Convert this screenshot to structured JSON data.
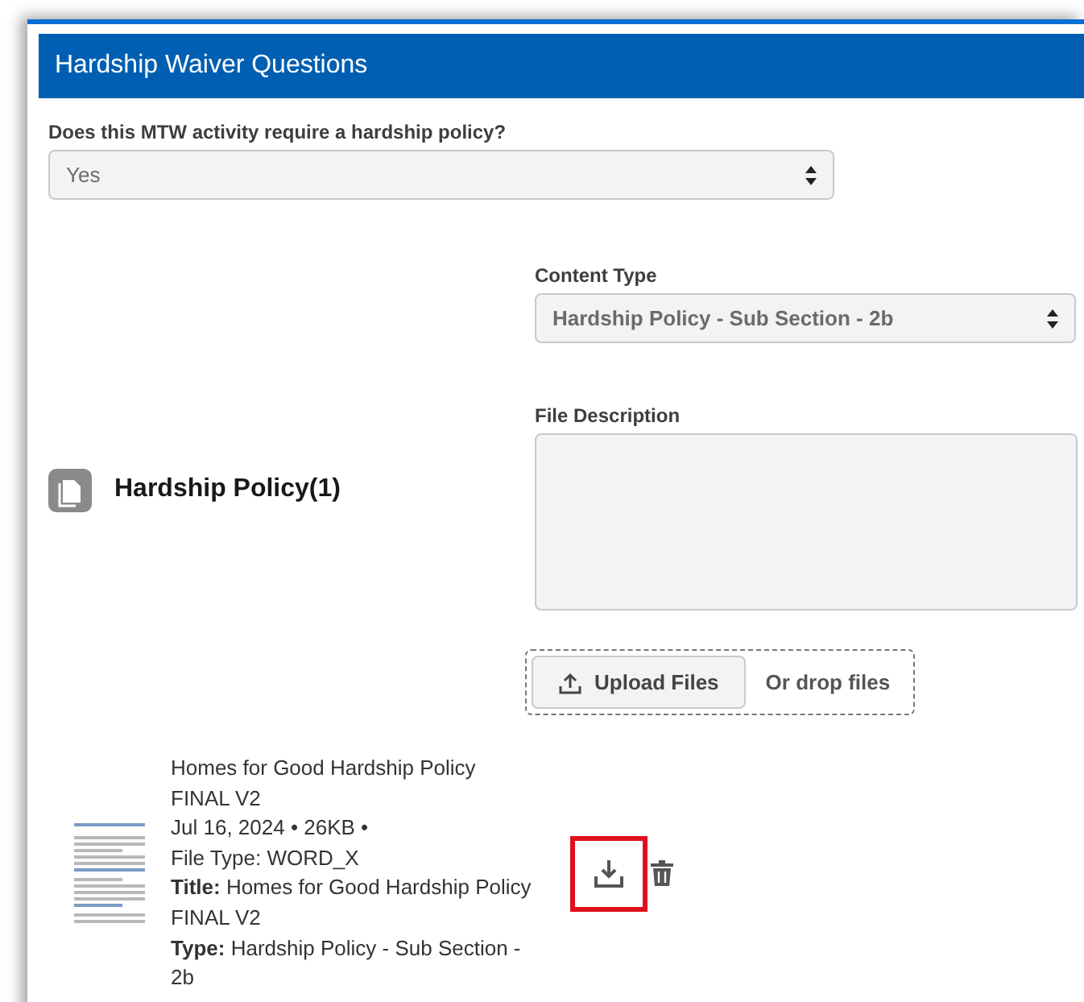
{
  "header": {
    "title": "Hardship Waiver Questions"
  },
  "question": {
    "label": "Does this MTW activity require a hardship policy?",
    "value": "Yes"
  },
  "section": {
    "title": "Hardship Policy(1)"
  },
  "content_type": {
    "label": "Content Type",
    "value": "Hardship Policy - Sub Section - 2b"
  },
  "file_description": {
    "label": "File Description"
  },
  "upload": {
    "button": "Upload Files",
    "drop_text": "Or drop files"
  },
  "file": {
    "name": "Homes for Good Hardship Policy FINAL V2",
    "meta": "Jul 16, 2024 • 26KB •",
    "file_type": "File Type: WORD_X",
    "title": "**Title:** Homes for Good Hardship Policy FINAL V2",
    "type": "**Type:** Hardship Policy - Sub Section - 2b",
    "download_highlighted": true
  }
}
